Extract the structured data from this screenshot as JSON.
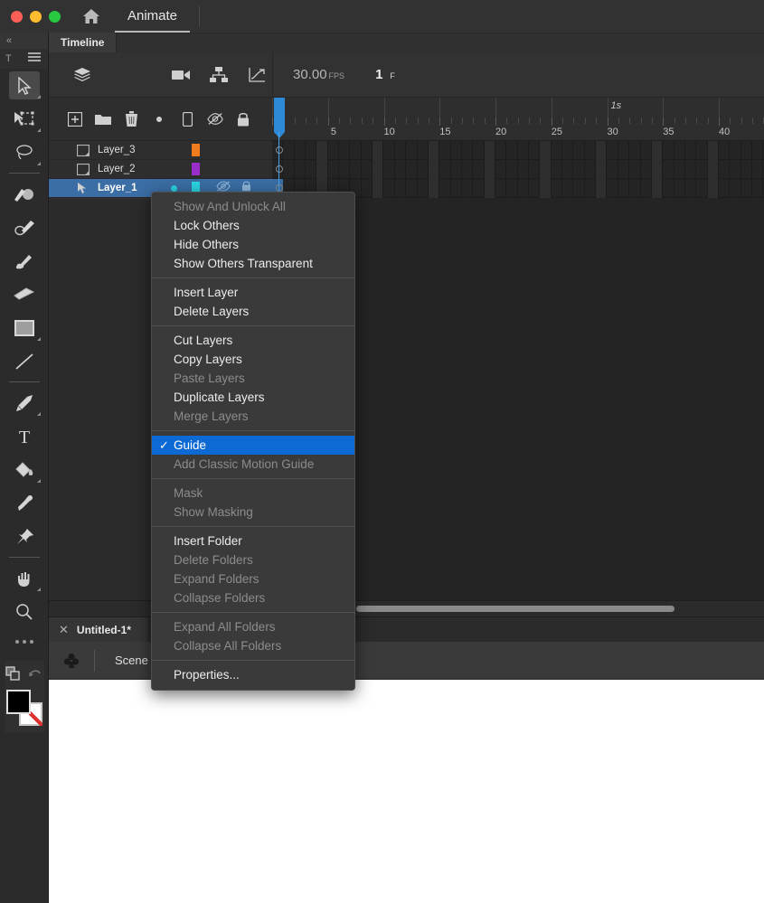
{
  "titlebar": {
    "window_controls": [
      "close",
      "minimize",
      "maximize"
    ],
    "home_icon": "home-icon",
    "app_tab_label": "Animate"
  },
  "toolbar": {
    "collapse_label": "«",
    "sub_left_label": "T",
    "sub_right_icon": "hamburger-icon",
    "tools": [
      {
        "name": "selection-tool",
        "icon": "cursor-arrow-icon",
        "active": true,
        "has_flyout": true
      },
      {
        "name": "free-transform-tool",
        "icon": "free-transform-icon",
        "active": false,
        "has_flyout": true
      },
      {
        "name": "lasso-tool",
        "icon": "lasso-icon",
        "active": false,
        "has_flyout": true
      },
      {
        "name": "brush-tool",
        "icon": "paint-brush-icon",
        "active": false,
        "has_flyout": false
      },
      {
        "name": "fluid-brush-tool",
        "icon": "fluid-brush-icon",
        "active": false,
        "has_flyout": false
      },
      {
        "name": "classic-brush-tool",
        "icon": "classic-brush-icon",
        "active": false,
        "has_flyout": false
      },
      {
        "name": "eraser-tool",
        "icon": "eraser-icon",
        "active": false,
        "has_flyout": false
      },
      {
        "name": "rectangle-tool",
        "icon": "rectangle-icon",
        "active": false,
        "has_flyout": true
      },
      {
        "name": "line-tool",
        "icon": "line-icon",
        "active": false,
        "has_flyout": false
      },
      {
        "name": "pen-tool",
        "icon": "pen-nib-icon",
        "active": false,
        "has_flyout": true
      },
      {
        "name": "text-tool",
        "icon": "text-t-icon",
        "active": false,
        "has_flyout": false
      },
      {
        "name": "paint-bucket-tool",
        "icon": "paint-bucket-icon",
        "active": false,
        "has_flyout": true
      },
      {
        "name": "eyedropper-tool",
        "icon": "eyedropper-icon",
        "active": false,
        "has_flyout": false
      },
      {
        "name": "width-tool",
        "icon": "push-pin-icon",
        "active": false,
        "has_flyout": false
      },
      {
        "name": "hand-tool",
        "icon": "hand-icon",
        "active": false,
        "has_flyout": true
      },
      {
        "name": "zoom-tool",
        "icon": "magnifier-icon",
        "active": false,
        "has_flyout": false
      }
    ],
    "more_tools_icon": "ellipsis-icon",
    "color": {
      "swap_icon": "swap-colors-icon",
      "reset_icon": "reset-colors-icon",
      "stroke_color": "#000000",
      "fill_color": "#ffffff"
    }
  },
  "timeline_panel": {
    "tab_label": "Timeline",
    "toolbar": {
      "layer_depth_icon": "layers-stack-icon",
      "camera_icon": "camera-icon",
      "layer_parenting_icon": "layer-parenting-icon",
      "graph_editor_icon": "graph-editor-icon",
      "fps_value": "30.00",
      "fps_unit": "FPS",
      "frame_value": "1",
      "frame_unit": "F"
    },
    "layer_toolbar_icons": [
      {
        "name": "new-layer-button",
        "icon": "plus-square-icon"
      },
      {
        "name": "new-folder-button",
        "icon": "folder-icon"
      },
      {
        "name": "delete-layer-button",
        "icon": "trash-icon"
      },
      {
        "name": "onion-skin-dot",
        "icon": "dot-icon"
      },
      {
        "name": "layer-color-button",
        "icon": "color-bar-icon"
      },
      {
        "name": "hide-all-layers-button",
        "icon": "eye-off-icon"
      },
      {
        "name": "lock-all-layers-button",
        "icon": "lock-icon"
      }
    ],
    "ruler": {
      "second_markers": [
        {
          "label": "1s",
          "frame": 30
        }
      ],
      "frame_numbers": [
        5,
        10,
        15,
        20,
        25,
        30,
        35,
        40
      ],
      "frames_visible": 44,
      "frame_width": 12.35
    },
    "layers": [
      {
        "name": "Layer_3",
        "type_icon": "layer-normal-icon",
        "color": "#f07c1e",
        "selected": false,
        "keyframe": "empty"
      },
      {
        "name": "Layer_2",
        "type_icon": "layer-normal-icon",
        "color": "#9a2ecb",
        "selected": false,
        "keyframe": "empty"
      },
      {
        "name": "Layer_1",
        "type_icon": "layer-guide-icon",
        "color": "#2ad4e0",
        "selected": true,
        "keyframe": "empty"
      }
    ],
    "playhead_frame": 1,
    "scrollbar": "horizontal-scrollbar"
  },
  "document": {
    "tab_label": "Untitled-1*",
    "tab_close_icon": "close-icon",
    "scene_icon": "scene-clubs-icon",
    "scene_label": "Scene"
  },
  "context_menu": {
    "groups": [
      {
        "items": [
          {
            "label": "Show And Unlock All",
            "state": "disabled"
          },
          {
            "label": "Lock Others",
            "state": "normal"
          },
          {
            "label": "Hide Others",
            "state": "normal"
          },
          {
            "label": "Show Others Transparent",
            "state": "normal"
          }
        ]
      },
      {
        "items": [
          {
            "label": "Insert Layer",
            "state": "normal"
          },
          {
            "label": "Delete Layers",
            "state": "normal"
          }
        ]
      },
      {
        "items": [
          {
            "label": "Cut Layers",
            "state": "normal"
          },
          {
            "label": "Copy Layers",
            "state": "normal"
          },
          {
            "label": "Paste Layers",
            "state": "disabled"
          },
          {
            "label": "Duplicate Layers",
            "state": "normal"
          },
          {
            "label": "Merge Layers",
            "state": "disabled"
          }
        ]
      },
      {
        "items": [
          {
            "label": "Guide",
            "state": "highlighted",
            "checked": true
          },
          {
            "label": "Add Classic Motion Guide",
            "state": "disabled"
          }
        ]
      },
      {
        "items": [
          {
            "label": "Mask",
            "state": "disabled"
          },
          {
            "label": "Show Masking",
            "state": "disabled"
          }
        ]
      },
      {
        "items": [
          {
            "label": "Insert Folder",
            "state": "normal"
          },
          {
            "label": "Delete Folders",
            "state": "disabled"
          },
          {
            "label": "Expand Folders",
            "state": "disabled"
          },
          {
            "label": "Collapse Folders",
            "state": "disabled"
          }
        ]
      },
      {
        "items": [
          {
            "label": "Expand All Folders",
            "state": "disabled"
          },
          {
            "label": "Collapse All Folders",
            "state": "disabled"
          }
        ]
      },
      {
        "items": [
          {
            "label": "Properties...",
            "state": "normal"
          }
        ]
      }
    ],
    "check_glyph": "✓",
    "highlight_color": "#0d6ad4"
  }
}
